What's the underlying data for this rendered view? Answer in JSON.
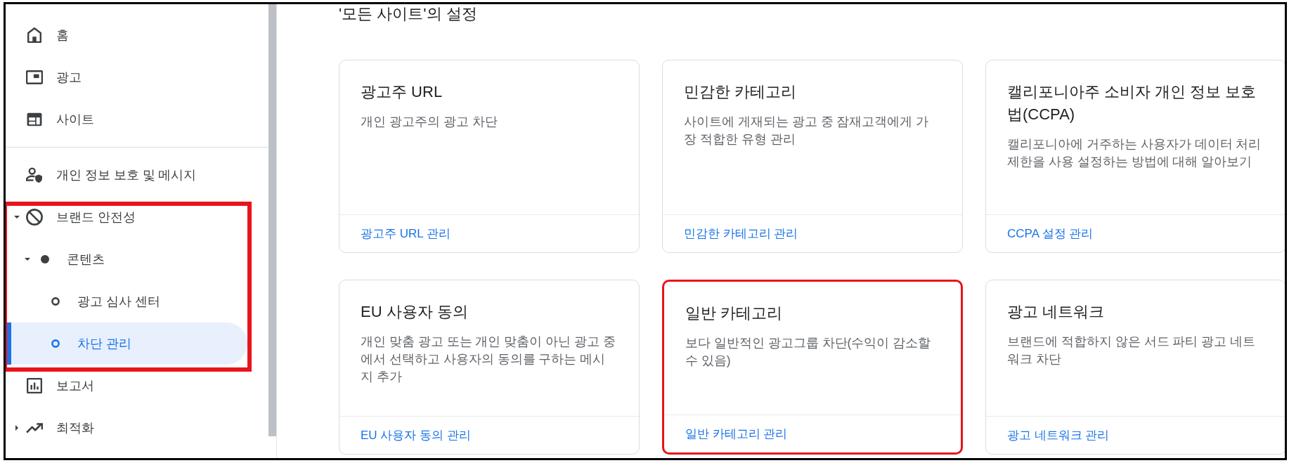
{
  "sidebar": {
    "sections": [
      {
        "items": [
          {
            "label": "홈",
            "selected": false
          },
          {
            "label": "광고",
            "selected": false
          },
          {
            "label": "사이트",
            "selected": false
          }
        ]
      },
      {
        "items": [
          {
            "label": "개인 정보 보호 및 메시지",
            "selected": false
          },
          {
            "label": "브랜드 안전성",
            "selected": false,
            "expanded": true,
            "highlighted": true,
            "children": [
              {
                "label": "콘텐츠",
                "selected": false,
                "expanded": true,
                "children": [
                  {
                    "label": "광고 심사 센터",
                    "selected": false
                  },
                  {
                    "label": "차단 관리",
                    "selected": true
                  }
                ]
              }
            ]
          },
          {
            "label": "보고서",
            "selected": false
          },
          {
            "label": "최적화",
            "selected": false,
            "expanded": false
          }
        ]
      }
    ]
  },
  "main": {
    "heading": "'모든 사이트'의 설정",
    "cards": [
      {
        "title": "광고주 URL",
        "description": "개인 광고주의 광고 차단",
        "link": "광고주 URL 관리",
        "highlighted": false
      },
      {
        "title": "민감한 카테고리",
        "description": "사이트에 게재되는 광고 중 잠재고객에게 가장 적합한 유형 관리",
        "link": "민감한 카테고리 관리",
        "highlighted": false
      },
      {
        "title": "캘리포니아주 소비자 개인 정보 보호법(CCPA)",
        "description": "캘리포니아에 거주하는 사용자가 데이터 처리 제한을 사용 설정하는 방법에 대해 알아보기",
        "link": "CCPA 설정 관리",
        "highlighted": false
      },
      {
        "title": "EU 사용자 동의",
        "description": "개인 맞춤 광고 또는 개인 맞춤이 아닌 광고 중에서 선택하고 사용자의 동의를 구하는 메시지 추가",
        "link": "EU 사용자 동의 관리",
        "highlighted": false
      },
      {
        "title": "일반 카테고리",
        "description": "보다 일반적인 광고그룹 차단(수익이 감소할 수 있음)",
        "link": "일반 카테고리 관리",
        "highlighted": true
      },
      {
        "title": "광고 네트워크",
        "description": "브랜드에 적합하지 않은 서드 파티 광고 네트워크 차단",
        "link": "광고 네트워크 관리",
        "highlighted": false
      }
    ]
  }
}
